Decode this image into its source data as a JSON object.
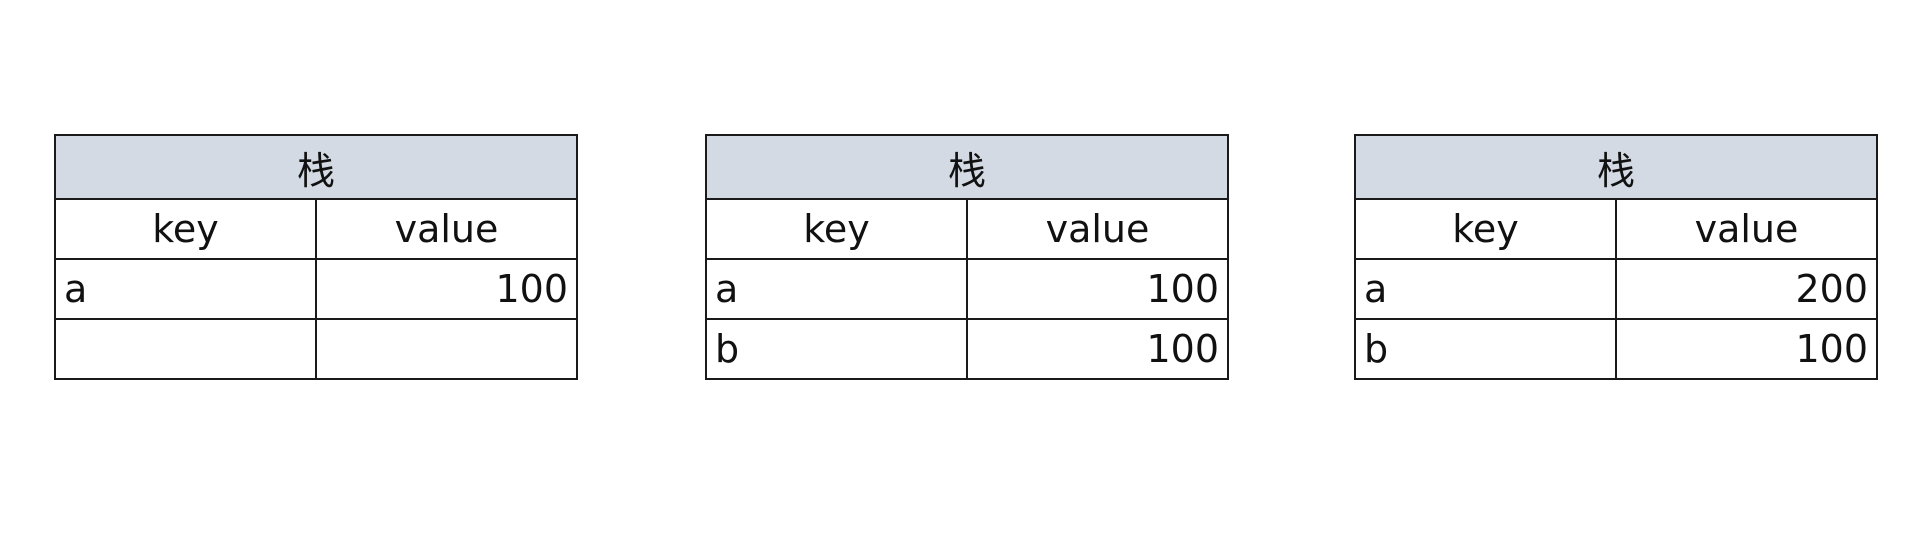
{
  "tables": [
    {
      "title": "栈",
      "headers": [
        "key",
        "value"
      ],
      "rows": [
        {
          "key": "a",
          "value": "100"
        },
        {
          "key": "",
          "value": ""
        }
      ]
    },
    {
      "title": "栈",
      "headers": [
        "key",
        "value"
      ],
      "rows": [
        {
          "key": "a",
          "value": "100"
        },
        {
          "key": "b",
          "value": "100"
        }
      ]
    },
    {
      "title": "栈",
      "headers": [
        "key",
        "value"
      ],
      "rows": [
        {
          "key": "a",
          "value": "200"
        },
        {
          "key": "b",
          "value": "100"
        }
      ]
    }
  ]
}
